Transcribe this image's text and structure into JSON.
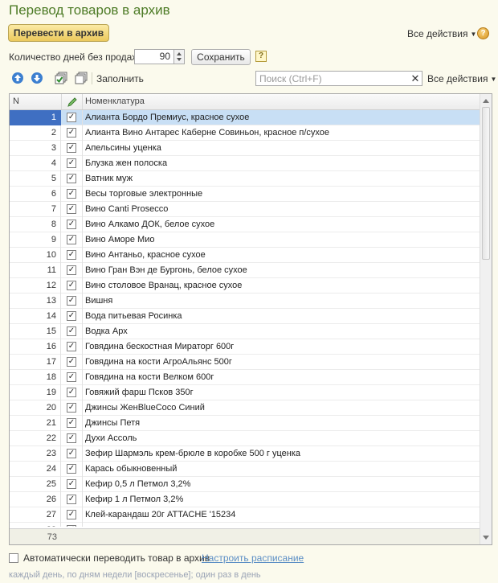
{
  "window": {
    "title": "Перевод товаров в архив"
  },
  "toolbar": {
    "archive_button": "Перевести в архив",
    "all_actions": "Все действия",
    "help": "?"
  },
  "settings": {
    "days_label": "Количество дней без продаж:",
    "days_value": "90",
    "save_button": "Сохранить",
    "hint_icon": "?"
  },
  "list_toolbar": {
    "fill": "Заполнить",
    "search_placeholder": "Поиск (Ctrl+F)",
    "clear": "✕",
    "all_actions": "Все действия"
  },
  "table": {
    "columns": {
      "n": "N",
      "name": "Номенклатура"
    },
    "rows": [
      {
        "n": "1",
        "name": "Алианта Бордо Премиус, красное сухое",
        "checked": true,
        "selected": true
      },
      {
        "n": "2",
        "name": "Алианта Вино Антарес Каберне Совиньон, красное п/сухое",
        "checked": true
      },
      {
        "n": "3",
        "name": "Апельсины уценка",
        "checked": true
      },
      {
        "n": "4",
        "name": "Блузка жен полоска",
        "checked": true
      },
      {
        "n": "5",
        "name": "Ватник муж",
        "checked": true
      },
      {
        "n": "6",
        "name": "Весы торговые электронные",
        "checked": true
      },
      {
        "n": "7",
        "name": "Вино Canti Prosecco",
        "checked": true
      },
      {
        "n": "8",
        "name": "Вино Алкамо ДОК, белое сухое",
        "checked": true
      },
      {
        "n": "9",
        "name": "Вино Аморе Мио",
        "checked": true
      },
      {
        "n": "10",
        "name": "Вино Антаньо, красное сухое",
        "checked": true
      },
      {
        "n": "11",
        "name": "Вино Гран Вэн де Бургонь, белое сухое",
        "checked": true
      },
      {
        "n": "12",
        "name": "Вино столовое Вранац, красное сухое",
        "checked": true
      },
      {
        "n": "13",
        "name": "Вишня",
        "checked": true
      },
      {
        "n": "14",
        "name": "Вода питьевая Росинка",
        "checked": true
      },
      {
        "n": "15",
        "name": "Водка Арх",
        "checked": true
      },
      {
        "n": "16",
        "name": "Говядина бескостная Мираторг 600г",
        "checked": true
      },
      {
        "n": "17",
        "name": "Говядина на кости АгроАльянс 500г",
        "checked": true
      },
      {
        "n": "18",
        "name": "Говядина на кости Велком 600г",
        "checked": true
      },
      {
        "n": "19",
        "name": "Говяжий фарш Псков 350г",
        "checked": true
      },
      {
        "n": "20",
        "name": "Джинсы ЖенBlueCoco Синий",
        "checked": true
      },
      {
        "n": "21",
        "name": "Джинсы Петя",
        "checked": true
      },
      {
        "n": "22",
        "name": "Духи Ассоль",
        "checked": true
      },
      {
        "n": "23",
        "name": "Зефир Шармэль крем-брюле в коробке 500 г уценка",
        "checked": true
      },
      {
        "n": "24",
        "name": "Карась обыкновенный",
        "checked": true
      },
      {
        "n": "25",
        "name": "Кефир 0,5 л  Петмол 3,2%",
        "checked": true
      },
      {
        "n": "26",
        "name": "Кефир 1 л  Петмол 3,2%",
        "checked": true
      },
      {
        "n": "27",
        "name": "Клей-карандаш 20г ATTACHE '15234",
        "checked": true
      },
      {
        "n": "28",
        "name": "",
        "checked": true
      }
    ],
    "total": "73"
  },
  "footer": {
    "auto_label": "Автоматически переводить товар в архив",
    "schedule_link": "Настроить расписание",
    "schedule_hint": "каждый день, по дням недели [воскресенье]; один раз в день"
  },
  "icons": {
    "move_up": "arrow-up-icon",
    "move_down": "arrow-down-icon",
    "check_all": "check-all-icon",
    "uncheck_all": "uncheck-all-icon",
    "edit_column": "pencil-icon"
  },
  "colors": {
    "title": "#4d7b26",
    "primary_button": "#ecc95c",
    "selection": "#3f6fc2",
    "row_selected": "#c8dff5",
    "link": "#5b8ec5"
  }
}
